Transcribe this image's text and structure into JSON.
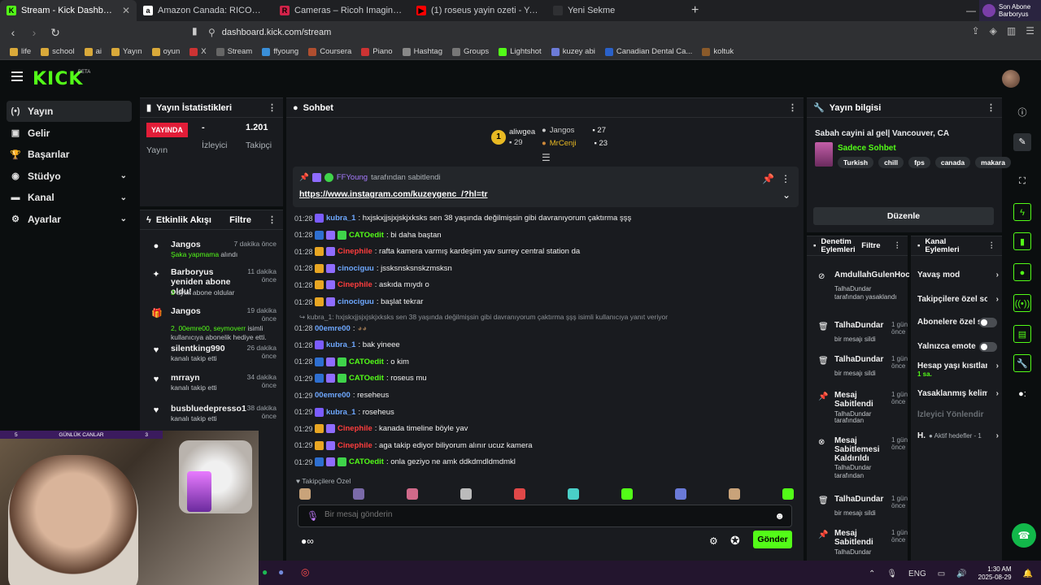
{
  "browser": {
    "tabs": [
      {
        "label": "Stream - Kick Dashboard",
        "color": "#53fc18",
        "glyph": "K",
        "active": true
      },
      {
        "label": "Amazon Canada: RICOH GR IIIx HDF",
        "color": "#ffffff",
        "glyph": "a"
      },
      {
        "label": "Cameras – Ricoh Imaging Canada",
        "color": "#d2234a",
        "glyph": "R"
      },
      {
        "label": "(1) roseus yayin ozeti - YouTube",
        "color": "#ff0000",
        "glyph": "▶"
      },
      {
        "label": "Yeni Sekme",
        "color": "#2f3033",
        "glyph": ""
      }
    ],
    "new_tab": "+",
    "notification": {
      "line1": "Son Abone",
      "line2": "Barboryus"
    },
    "url": "dashboard.kick.com/stream",
    "bookmarks": [
      "life",
      "school",
      "ai",
      "Yayın",
      "oyun",
      "X",
      "Stream",
      "ffyoung",
      "Coursera",
      "Piano",
      "Hashtag",
      "Groups",
      "Lightshot",
      "kuzey abi",
      "Canadian Dental Ca...",
      "koltuk"
    ]
  },
  "header": {
    "logo": "KICK",
    "beta": "BETA"
  },
  "sidebar": {
    "items": [
      {
        "label": "Yayın",
        "icon": "(•)",
        "active": true
      },
      {
        "label": "Gelir",
        "icon": "▣"
      },
      {
        "label": "Başarılar",
        "icon": "🏆"
      },
      {
        "label": "Stüdyo",
        "icon": "◉",
        "chevron": "⌄"
      },
      {
        "label": "Kanal",
        "icon": "▬",
        "chevron": "⌄"
      },
      {
        "label": "Ayarlar",
        "icon": "⚙",
        "chevron": "⌄"
      }
    ]
  },
  "stats": {
    "title": "Yayın İstatistikleri",
    "live_badge": "YAYINDA",
    "live_label": "Yayın",
    "viewers_value": "-",
    "viewers_label": "İzleyici",
    "followers_value": "1.201",
    "followers_label": "Takipçi"
  },
  "activity": {
    "title": "Etkinlik Akışı",
    "filter": "Filtre",
    "items": [
      {
        "name": "Jangos",
        "time": "7 dakika önce",
        "sub_green": "Şaka yapmama",
        "sub": " alındı",
        "icon": "●"
      },
      {
        "name": "Barboryus yeniden abone oldu!",
        "time": "11 dakika önce",
        "sub_green": "3",
        "sub": " aylık abone oldular",
        "icon": "✦"
      },
      {
        "name": "Jangos",
        "time": "19 dakika önce",
        "sub_green": "2, 00emre00, seymoverr",
        "sub": " isimli kullanıcıya abonelik hediye etti.",
        "icon": "🎁"
      },
      {
        "name": "silentking990",
        "time": "26 dakika önce",
        "sub_green": "",
        "sub": "kanalı takip etti",
        "icon": "♥"
      },
      {
        "name": "mrrayn",
        "time": "34 dakika önce",
        "sub_green": "",
        "sub": "kanalı takip etti",
        "icon": "♥"
      },
      {
        "name": "busbluedepresso1",
        "time": "38 dakika önce",
        "sub_green": "",
        "sub": "kanalı takip etti",
        "icon": "♥"
      }
    ]
  },
  "chat": {
    "title": "Sohbet",
    "leaders": {
      "first": {
        "name": "aliwgea",
        "count": "29",
        "rank": "1"
      },
      "second": {
        "name": "Jangos",
        "count": "27"
      },
      "third": {
        "name": "MrCenji",
        "count": "23"
      }
    },
    "pinned": {
      "user": "FFYoung",
      "suffix": "tarafından sabitlendi",
      "link": "https://www.instagram.com/kuzeygenc_/?hl=tr"
    },
    "messages": [
      {
        "time": "01:28",
        "user": "kubra_1",
        "ucolor": "#6ea8ff",
        "text": ": hxjskxjjsjxjskjxksks sen 38 yaşında değilmişsin gibi davranıyorum çaktırma şşş",
        "badges": [
          "#7b5cff"
        ]
      },
      {
        "time": "01:28",
        "user": "CATOedit",
        "ucolor": "#53fc18",
        "text": ": bi daha baştan",
        "badges": [
          "#2e6fd0",
          "#8f6cff",
          "#3fd44a"
        ]
      },
      {
        "time": "01:28",
        "user": "Cinephile",
        "ucolor": "#ff3d3d",
        "text": ": rafta kamera varmış kardeşim yav surrey central station da",
        "badges": [
          "#e8a623",
          "#8f6cff"
        ]
      },
      {
        "time": "01:28",
        "user": "cinociguu",
        "ucolor": "#6ea8ff",
        "text": ": jssksnsksnskzmsksn",
        "badges": [
          "#e8a623",
          "#8f6cff"
        ]
      },
      {
        "time": "01:28",
        "user": "Cinephile",
        "ucolor": "#ff3d3d",
        "text": ": askıda mıydı o",
        "badges": [
          "#e8a623",
          "#8f6cff"
        ]
      },
      {
        "time": "01:28",
        "user": "cinociguu",
        "ucolor": "#6ea8ff",
        "text": ": başlat tekrar",
        "badges": [
          "#e8a623",
          "#8f6cff"
        ]
      },
      {
        "time": "01:28",
        "user": "00emre00",
        "ucolor": "#6ea8ff",
        "text": ":",
        "badges": [],
        "reply": "↪ kubra_1: hxjskxjjsjxjskjxksks sen 38 yaşında değilmişsin gibi davranıyorum çaktırma şşş isimli kullanıcıya yanıt veriyor"
      },
      {
        "time": "01:28",
        "user": "kubra_1",
        "ucolor": "#6ea8ff",
        "text": ": bak yineee",
        "badges": [
          "#7b5cff"
        ]
      },
      {
        "time": "01:28",
        "user": "CATOedit",
        "ucolor": "#53fc18",
        "text": ": o kim",
        "badges": [
          "#2e6fd0",
          "#8f6cff",
          "#3fd44a"
        ]
      },
      {
        "time": "01:29",
        "user": "CATOedit",
        "ucolor": "#53fc18",
        "text": ": roseus mu",
        "badges": [
          "#2e6fd0",
          "#8f6cff",
          "#3fd44a"
        ]
      },
      {
        "time": "01:29",
        "user": "00emre00",
        "ucolor": "#6ea8ff",
        "text": ": reseheus",
        "badges": []
      },
      {
        "time": "01:29",
        "user": "kubra_1",
        "ucolor": "#6ea8ff",
        "text": ": roseheus",
        "badges": [
          "#7b5cff"
        ]
      },
      {
        "time": "01:29",
        "user": "Cinephile",
        "ucolor": "#ff3d3d",
        "text": ": kanada timeline böyle yav",
        "badges": [
          "#e8a623",
          "#8f6cff"
        ]
      },
      {
        "time": "01:29",
        "user": "Cinephile",
        "ucolor": "#ff3d3d",
        "text": ": aga takip ediyor biliyorum alınır ucuz kamera",
        "badges": [
          "#e8a623",
          "#8f6cff"
        ]
      },
      {
        "time": "01:29",
        "user": "CATOedit",
        "ucolor": "#53fc18",
        "text": ": onla geziyo ne amk ddkdmdldmdmkl",
        "badges": [
          "#2e6fd0",
          "#8f6cff",
          "#3fd44a"
        ]
      }
    ],
    "followers_only": "Takipçilere Özel",
    "input_placeholder": "Bir mesaj gönderin",
    "send_label": "Gönder"
  },
  "stream_info": {
    "title": "Yayın bilgisi",
    "stream_title": "Sabah cayini al gel| Vancouver, CA",
    "category": "Sadece Sohbet",
    "tags": [
      "Turkish",
      "chill",
      "fps",
      "canada",
      "makara"
    ],
    "edit_label": "Düzenle"
  },
  "mod_actions": {
    "title": "Denetim Eylemleri",
    "filter": "Filtre",
    "items": [
      {
        "name": "AmdullahGulenHocam",
        "time": "",
        "sub_green": "TalhaDundar",
        "sub": "tarafından yasaklandı",
        "icon": "⊘"
      },
      {
        "name": "TalhaDundar",
        "time": "1 gün önce",
        "sub_green": "",
        "sub": "bir mesajı sildi",
        "icon": "🗑"
      },
      {
        "name": "TalhaDundar",
        "time": "1 gün önce",
        "sub_green": "",
        "sub": "bir mesajı sildi",
        "icon": "🗑"
      },
      {
        "name": "Mesaj Sabitlendi",
        "time": "1 gün önce",
        "sub_green": "TalhaDundar",
        "sub": "tarafından",
        "icon": "📌"
      },
      {
        "name": "Mesaj Sabitlemesi Kaldırıldı",
        "time": "1 gün önce",
        "sub_green": "TalhaDundar",
        "sub": "tarafından",
        "icon": "⊗"
      },
      {
        "name": "TalhaDundar",
        "time": "1 gün önce",
        "sub_green": "",
        "sub": "bir mesajı sildi",
        "icon": "🗑"
      },
      {
        "name": "Mesaj Sabitlendi",
        "time": "1 gün önce",
        "sub_green": "TalhaDundar",
        "sub": "",
        "icon": "📌"
      }
    ]
  },
  "channel_actions": {
    "title": "Kanal Eylemleri",
    "items": [
      {
        "label": "Yavaş mod",
        "kind": "chevron"
      },
      {
        "label": "Takipçilere özel sohbet",
        "kind": "chevron"
      },
      {
        "label": "Abonelere özel sohbet",
        "kind": "toggle"
      },
      {
        "label": "Yalnızca emote",
        "kind": "toggle"
      },
      {
        "label": "Hesap yaşı kısıtlaması",
        "kind": "chevron",
        "sub": "1 sa."
      },
      {
        "label": "Yasaklanmış kelimeler",
        "kind": "chevron"
      },
      {
        "label": "İzleyici Yönlendir",
        "kind": "disabled"
      },
      {
        "label": "H.",
        "kind": "chevron",
        "extra": "● Aktif hedefler - 1"
      }
    ]
  },
  "webcam": {
    "left": "5",
    "title": "GÜNLÜK CANLAR",
    "right": "3"
  },
  "taskbar": {
    "lang": "ENG",
    "time": "1:30 AM",
    "date": "2025-08-29"
  }
}
